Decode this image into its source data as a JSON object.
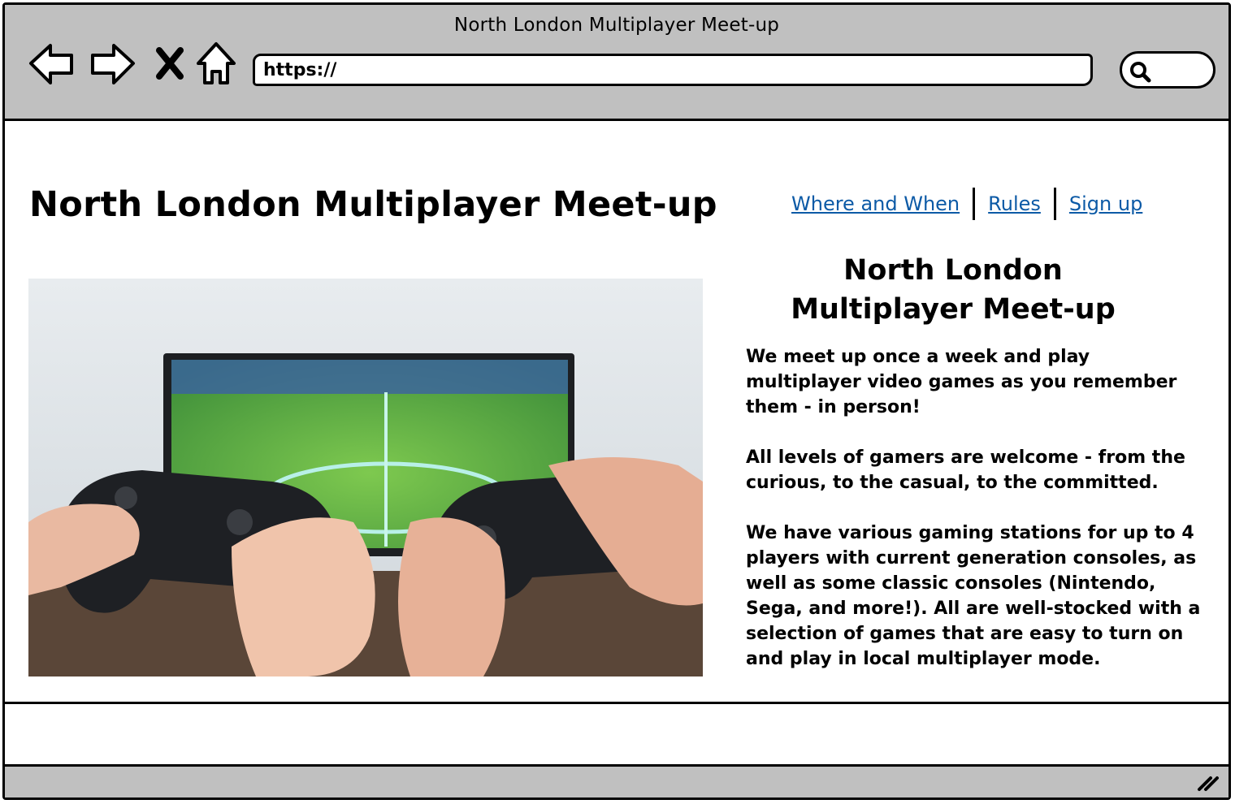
{
  "window": {
    "title": "North London Multiplayer Meet-up"
  },
  "toolbar": {
    "back_icon": "back-arrow-icon",
    "forward_icon": "forward-arrow-icon",
    "stop_icon": "close-icon",
    "home_icon": "home-icon",
    "url": "https://",
    "search_icon": "search-icon"
  },
  "header": {
    "site_title": "North London Multiplayer Meet-up",
    "nav": [
      {
        "label": "Where and When"
      },
      {
        "label": "Rules"
      },
      {
        "label": "Sign up"
      }
    ],
    "link_color": "#0c5aa6"
  },
  "main": {
    "image_alt": "Two people holding game controllers in front of a TV showing a football game",
    "info_title_line1": "North London",
    "info_title_line2": "Multiplayer Meet-up",
    "paragraphs": [
      "We meet up once a week and play multiplayer video games as you remember them - in person!",
      "All levels of gamers are welcome - from the curious, to the casual, to the committed.",
      "We have various gaming stations for up to 4 players with current generation consoles, as well as some classic consoles (Nintendo, Sega, and more!). All are well-stocked with a selection of games that are easy to turn on and play in local multiplayer mode."
    ]
  },
  "colors": {
    "chrome": "#c0c0c0",
    "border": "#000000"
  }
}
